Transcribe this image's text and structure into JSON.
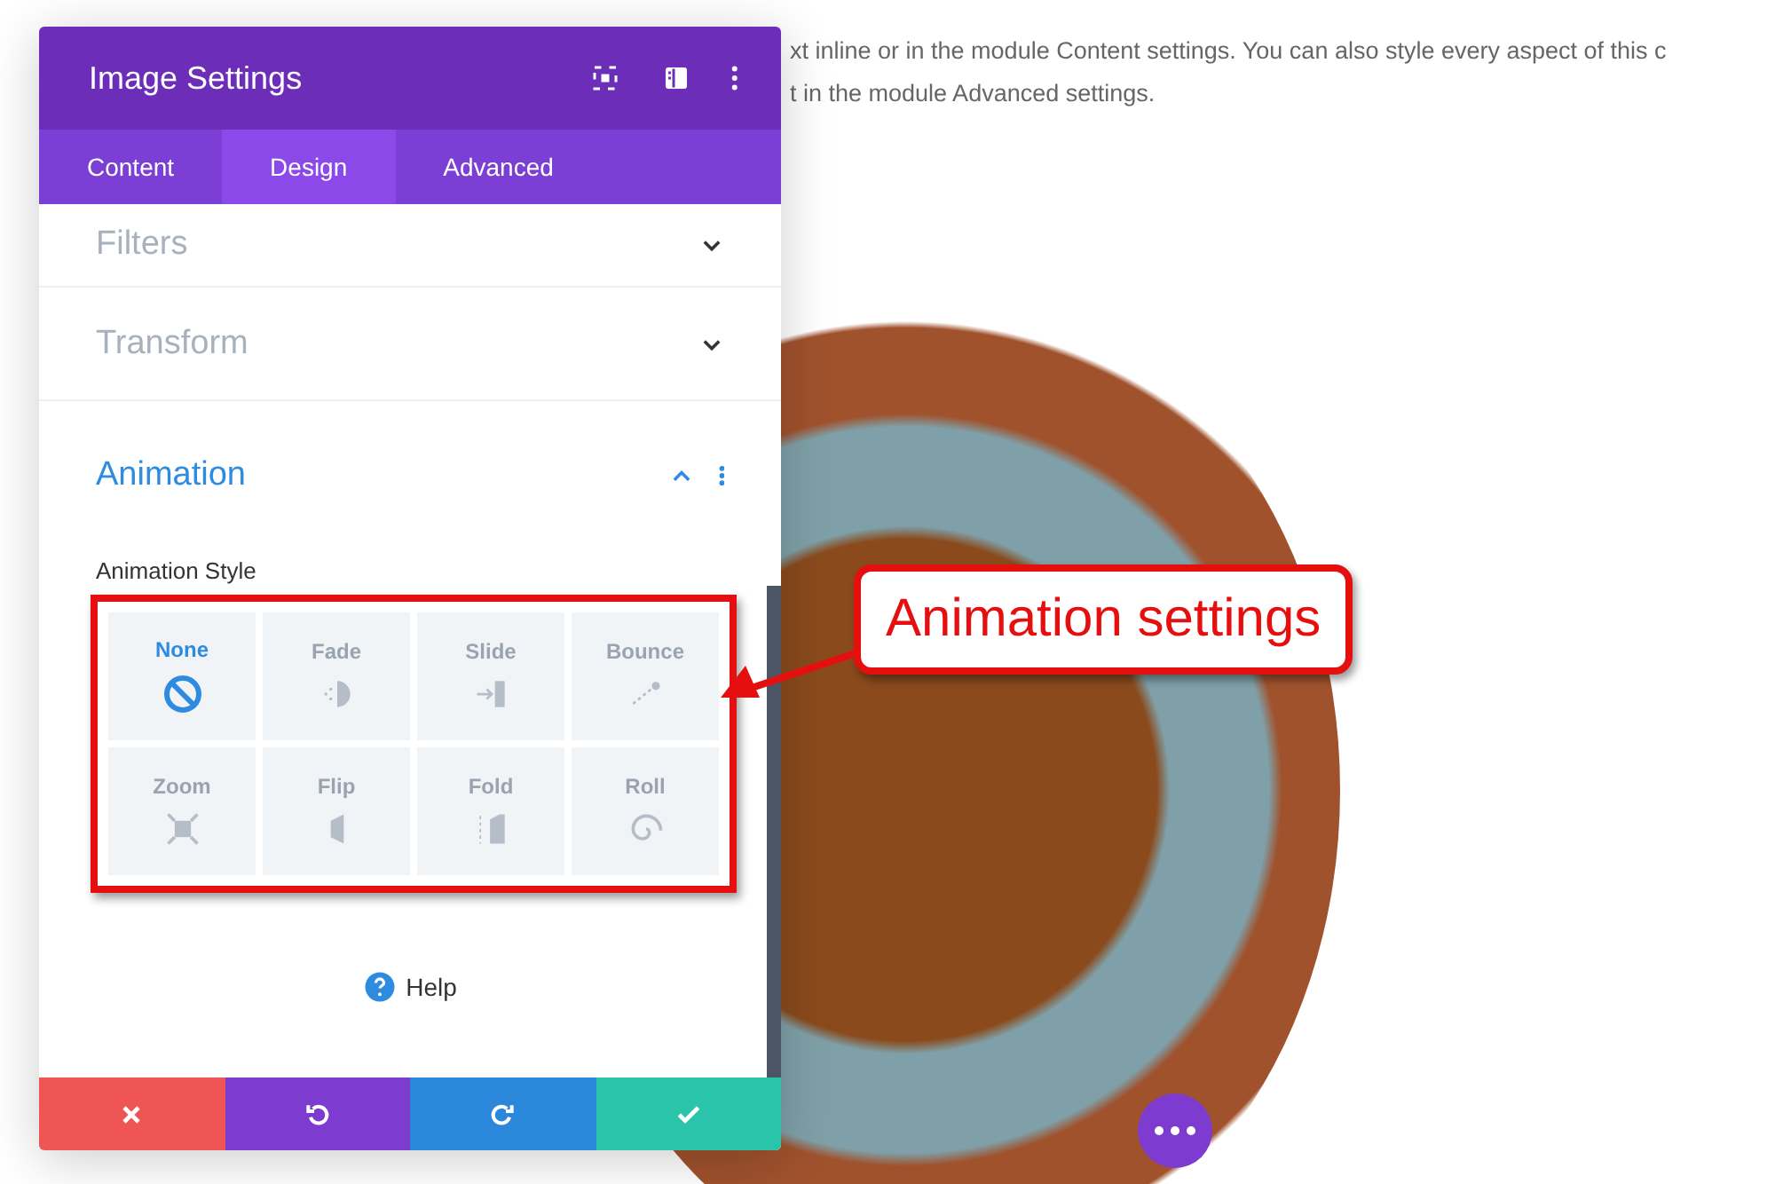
{
  "page_text": [
    "xt inline or in the module Content settings. You can also style every aspect of this c",
    "t in the module Advanced settings."
  ],
  "panel": {
    "title": "Image Settings",
    "tabs": [
      {
        "label": "Content",
        "selected": false
      },
      {
        "label": "Design",
        "selected": true
      },
      {
        "label": "Advanced",
        "selected": false
      }
    ],
    "sections": [
      {
        "label": "Filters",
        "expanded": false
      },
      {
        "label": "Transform",
        "expanded": false
      },
      {
        "label": "Animation",
        "expanded": true
      }
    ],
    "field_label": "Animation Style",
    "styles": [
      {
        "label": "None",
        "kind": "none",
        "selected": true
      },
      {
        "label": "Fade",
        "kind": "fade",
        "selected": false
      },
      {
        "label": "Slide",
        "kind": "slide",
        "selected": false
      },
      {
        "label": "Bounce",
        "kind": "bounce",
        "selected": false
      },
      {
        "label": "Zoom",
        "kind": "zoom",
        "selected": false
      },
      {
        "label": "Flip",
        "kind": "flip",
        "selected": false
      },
      {
        "label": "Fold",
        "kind": "fold",
        "selected": false
      },
      {
        "label": "Roll",
        "kind": "roll",
        "selected": false
      }
    ],
    "help": "Help",
    "actions": [
      {
        "kind": "cancel"
      },
      {
        "kind": "undo"
      },
      {
        "kind": "redo"
      },
      {
        "kind": "save"
      }
    ]
  },
  "callout": "Animation settings"
}
